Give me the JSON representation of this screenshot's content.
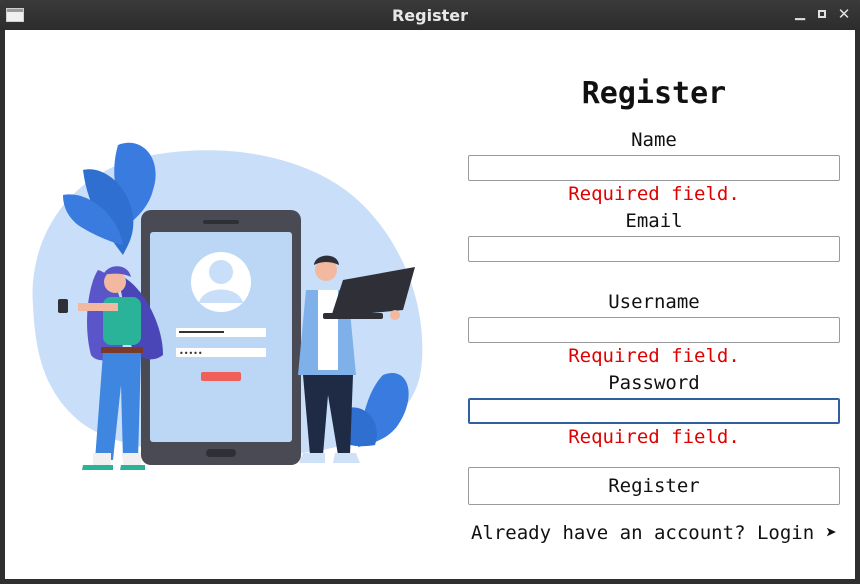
{
  "window": {
    "title": "Register"
  },
  "form": {
    "heading": "Register",
    "name_label": "Name",
    "name_value": "",
    "name_error": "Required field.",
    "email_label": "Email",
    "email_value": "",
    "username_label": "Username",
    "username_value": "",
    "username_error": "Required field.",
    "password_label": "Password",
    "password_value": "",
    "password_error": "Required field.",
    "submit_label": "Register",
    "login_text": "Already have an account? Login ➤"
  },
  "illustration": {
    "password_dots": "•••••"
  },
  "colors": {
    "error": "#e00000",
    "blob": "#c9def8",
    "phone_frame": "#4a4a55",
    "screen": "#bcd6f6",
    "leaf": "#3a7be0",
    "accent_button": "#f0605a"
  }
}
